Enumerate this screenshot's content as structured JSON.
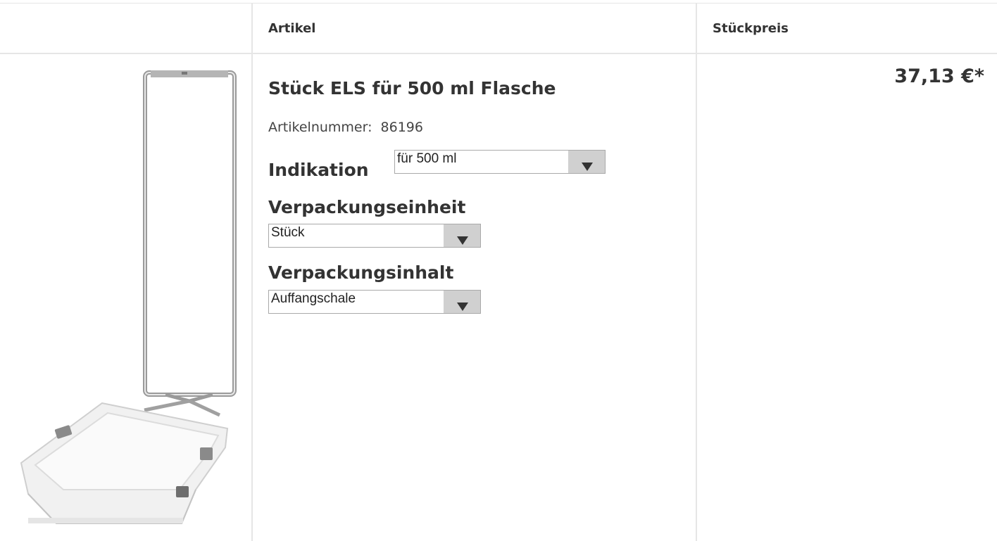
{
  "table": {
    "headers": {
      "article": "Artikel",
      "unit_price": "Stückpreis"
    }
  },
  "product": {
    "title": "Stück ELS für 500 ml Flasche",
    "article_number_label": "Artikelnummer:",
    "article_number": "86196",
    "price": "37,13 €*",
    "image_icon": "wall-bracket-with-drip-tray"
  },
  "options": {
    "indikation": {
      "label": "Indikation",
      "value": "für 500 ml"
    },
    "verpackungseinheit": {
      "label": "Verpackungseinheit",
      "value": "Stück"
    },
    "verpackungsinhalt": {
      "label": "Verpackungsinhalt",
      "value": "Auffangschale"
    }
  }
}
